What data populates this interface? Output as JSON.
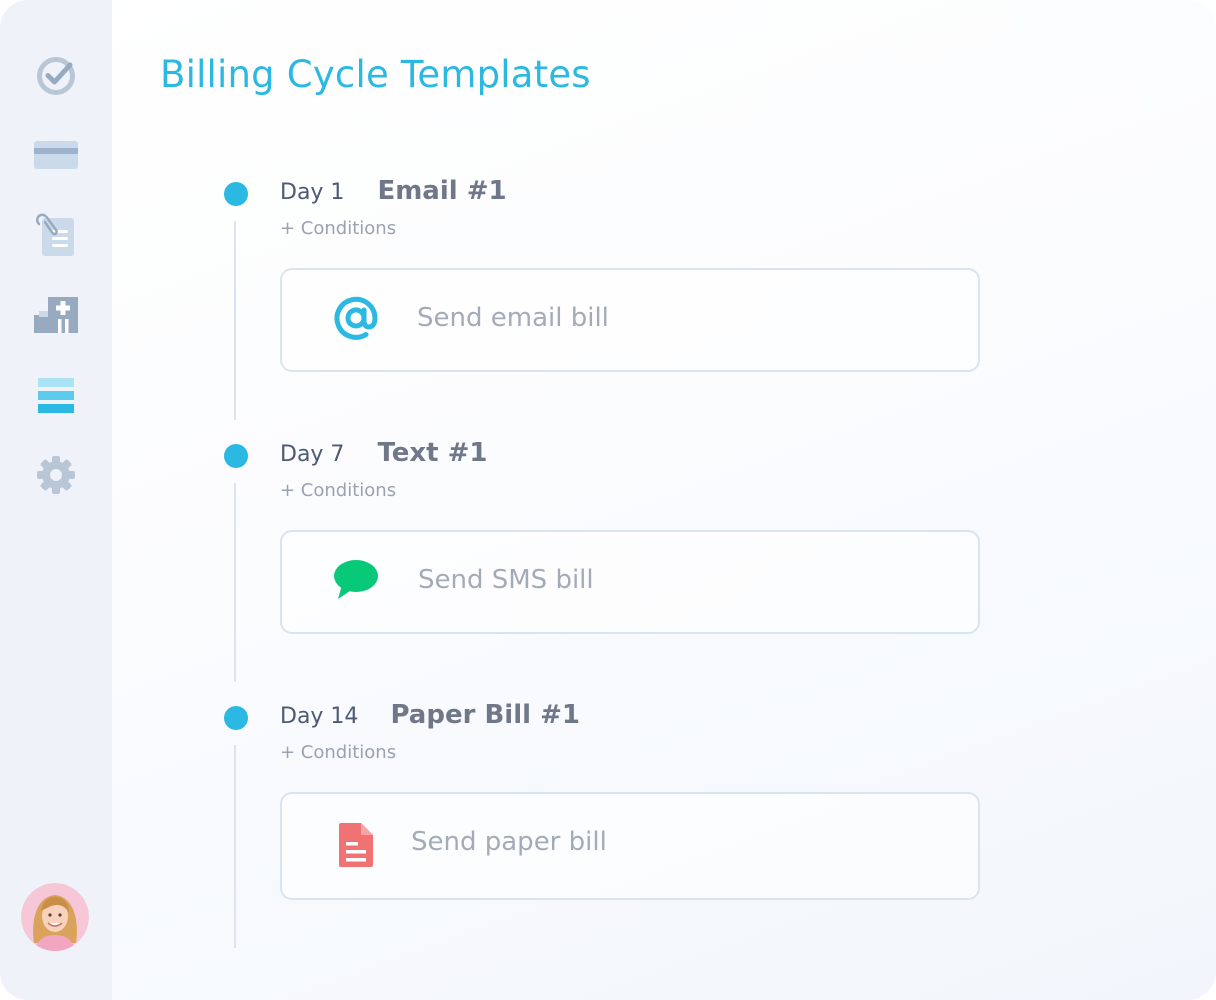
{
  "page": {
    "title": "Billing Cycle Templates"
  },
  "sidebar": {
    "items": [
      {
        "icon": "check-circle-icon"
      },
      {
        "icon": "credit-card-icon"
      },
      {
        "icon": "clipboard-list-icon"
      },
      {
        "icon": "clinic-building-icon"
      },
      {
        "icon": "stacked-layers-icon",
        "active": true
      },
      {
        "icon": "gear-icon"
      }
    ],
    "avatar": "user-avatar"
  },
  "colors": {
    "accent": "#2bb8e2",
    "sms_green": "#08c977",
    "paper_red": "#f07272",
    "muted_text": "#a4abb8"
  },
  "steps": [
    {
      "day": "Day 1",
      "name": "Email #1",
      "conditions": "+ Conditions",
      "action_icon": "at-sign-icon",
      "action_label": "Send email bill"
    },
    {
      "day": "Day 7",
      "name": "Text #1",
      "conditions": "+ Conditions",
      "action_icon": "chat-bubble-icon",
      "action_label": "Send SMS bill"
    },
    {
      "day": "Day 14",
      "name": "Paper Bill #1",
      "conditions": "+ Conditions",
      "action_icon": "document-icon",
      "action_label": "Send paper bill"
    }
  ]
}
